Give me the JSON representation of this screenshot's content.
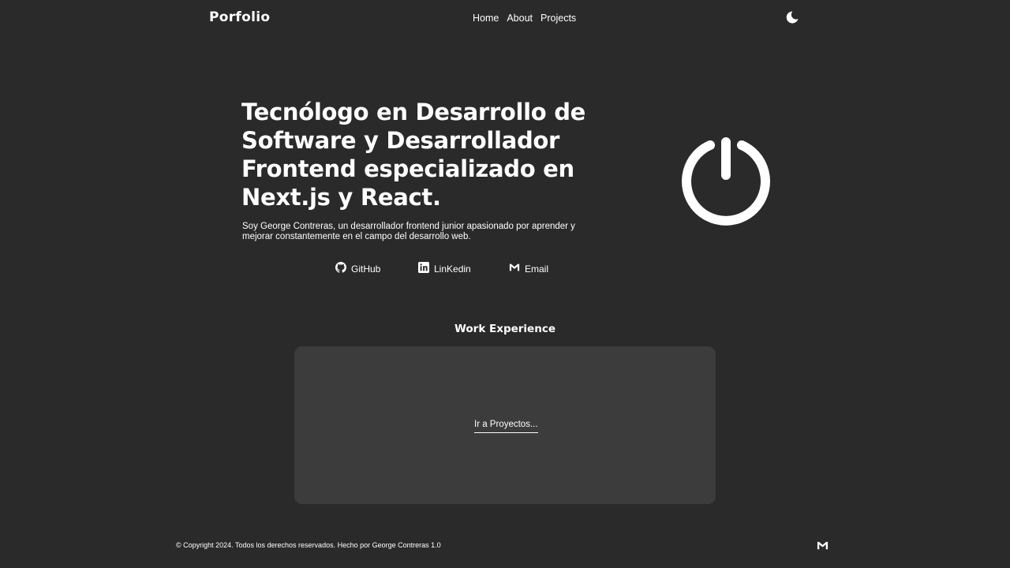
{
  "header": {
    "logo": "Porfolio",
    "nav": [
      "Home",
      "About",
      "Projects"
    ],
    "theme_icon": "moon-icon"
  },
  "hero": {
    "title": "Tecnólogo en Desarrollo de Software y Desarrollador Frontend especializado en Next.js y React.",
    "description": "Soy George Contreras, un desarrollador frontend junior apasionado por aprender y mejorar constantemente en el campo del desarrollo web.",
    "illustration_icon": "power-icon"
  },
  "social": {
    "github": {
      "label": "GitHub",
      "icon": "github-icon"
    },
    "linkedin": {
      "label": "LinKedin",
      "icon": "linkedin-icon"
    },
    "email": {
      "label": "Email",
      "icon": "gmail-icon"
    }
  },
  "work": {
    "title": "Work Experience",
    "link": "Ir a Proyectos..."
  },
  "footer": {
    "text": "© Copyright 2024. Todos los derechos reservados. Hecho por George Contreras 1.0",
    "icon": "gmail-icon"
  },
  "colors": {
    "background": "#2a2a2a",
    "card": "#3c3c3c",
    "text": "#ffffff"
  }
}
